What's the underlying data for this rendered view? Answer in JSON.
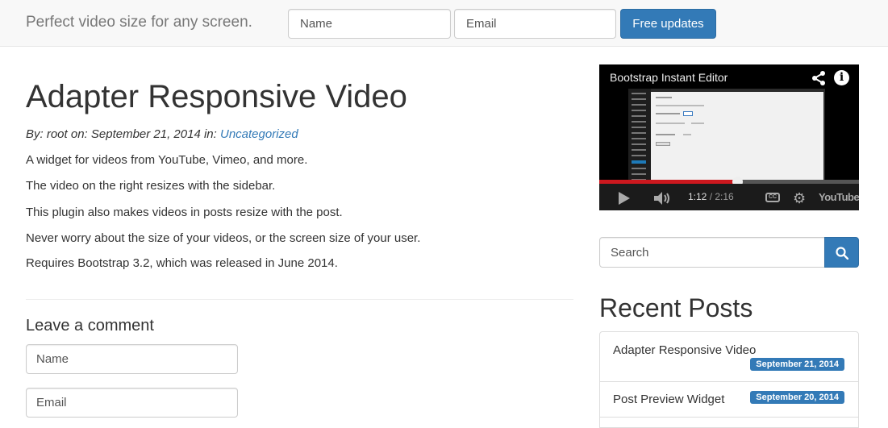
{
  "navbar": {
    "brand": "Perfect video size for any screen.",
    "name_placeholder": "Name",
    "email_placeholder": "Email",
    "submit_label": "Free updates"
  },
  "post": {
    "title": "Adapter Responsive Video",
    "meta_prefix": "By: root on: September 21, 2014 in:",
    "category": "Uncategorized",
    "paragraphs": [
      "A widget for videos from YouTube, Vimeo, and more.",
      "The video on the right resizes with the sidebar.",
      "This plugin also makes videos in posts resize with the post.",
      "Never worry about the size of your videos, or the screen size of your user.",
      "Requires Bootstrap 3.2, which was released in June 2014."
    ]
  },
  "comment_form": {
    "heading": "Leave a comment",
    "name_placeholder": "Name",
    "email_placeholder": "Email"
  },
  "video": {
    "title": "Bootstrap Instant Editor",
    "current_time": "1:12",
    "separator": " / ",
    "duration": "2:16",
    "progress_fraction": 0.53,
    "cc_label": "CC",
    "brand": "YouTube",
    "icons": [
      "share-icon",
      "info-icon",
      "play-icon",
      "volume-icon",
      "cc-icon",
      "gear-icon"
    ]
  },
  "search": {
    "placeholder": "Search",
    "icon": "search-icon"
  },
  "recent_posts": {
    "heading": "Recent Posts",
    "items": [
      {
        "title": "Adapter Responsive Video",
        "date": "September 21, 2014"
      },
      {
        "title": "Post Preview Widget",
        "date": "September 20, 2014"
      }
    ]
  },
  "colors": {
    "primary": "#337ab7",
    "navbar_bg": "#f8f8f8",
    "progress_red": "#cc181e"
  }
}
